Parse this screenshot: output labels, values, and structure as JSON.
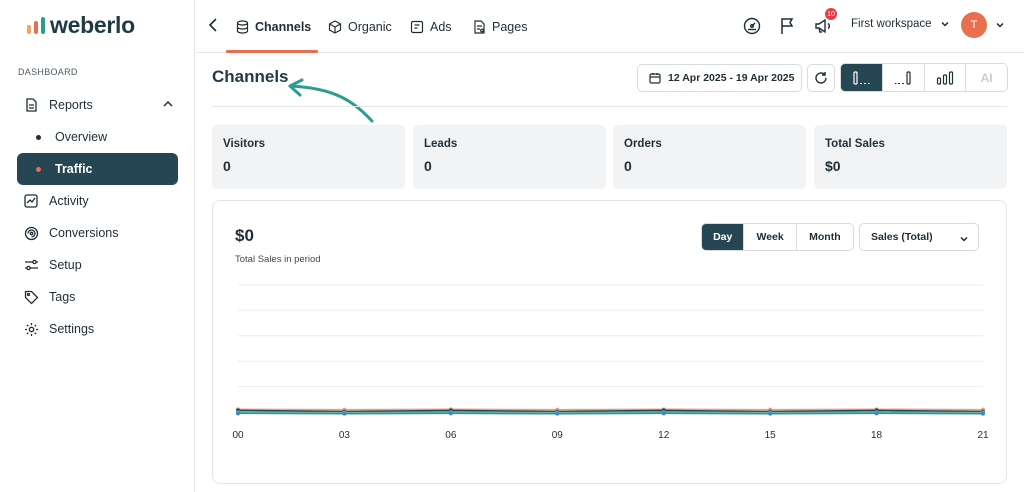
{
  "brand": {
    "name": "weberlo"
  },
  "sidebar": {
    "section_label": "DASHBOARD",
    "reports_label": "Reports",
    "sub_items": [
      {
        "label": "Overview",
        "active": false
      },
      {
        "label": "Traffic",
        "active": true
      }
    ],
    "items": [
      {
        "label": "Activity",
        "icon": "activity-chart-icon"
      },
      {
        "label": "Conversions",
        "icon": "conversions-swirl-icon"
      },
      {
        "label": "Setup",
        "icon": "setup-sliders-icon"
      },
      {
        "label": "Tags",
        "icon": "tag-icon"
      },
      {
        "label": "Settings",
        "icon": "gear-icon"
      }
    ]
  },
  "topnav": {
    "tabs": [
      {
        "label": "Channels",
        "icon": "database-icon",
        "active": true
      },
      {
        "label": "Organic",
        "icon": "cube-icon",
        "active": false
      },
      {
        "label": "Ads",
        "icon": "ad-tag-icon",
        "active": false
      },
      {
        "label": "Pages",
        "icon": "page-icon",
        "active": false
      }
    ],
    "notification_count": "10",
    "workspace": "First workspace",
    "avatar_initial": "T"
  },
  "page": {
    "title": "Channels",
    "date_range": "12 Apr 2025 - 19 Apr 2025",
    "view_ai_label": "AI"
  },
  "stats": [
    {
      "label": "Visitors",
      "value": "0"
    },
    {
      "label": "Leads",
      "value": "0"
    },
    {
      "label": "Orders",
      "value": "0"
    },
    {
      "label": "Total Sales",
      "value": "$0"
    }
  ],
  "chart_panel": {
    "total": "$0",
    "subtitle": "Total Sales in period",
    "periods": [
      {
        "label": "Day",
        "active": true
      },
      {
        "label": "Week",
        "active": false
      },
      {
        "label": "Month",
        "active": false
      }
    ],
    "metric": "Sales (Total)"
  },
  "colors": {
    "primary": "#264653",
    "accent": "#e76f51",
    "series": [
      "#e9a07f",
      "#264653",
      "#6bbf8a",
      "#3a86c8"
    ]
  },
  "chart_data": {
    "type": "line",
    "x": [
      "00",
      "03",
      "06",
      "09",
      "12",
      "15",
      "18",
      "21"
    ],
    "series": [
      {
        "values": [
          0,
          0,
          0,
          0,
          0,
          0,
          0,
          0
        ]
      },
      {
        "values": [
          0,
          0,
          0,
          0,
          0,
          0,
          0,
          0
        ]
      },
      {
        "values": [
          0,
          0,
          0,
          0,
          0,
          0,
          0,
          0
        ]
      },
      {
        "values": [
          0,
          0,
          0,
          0,
          0,
          0,
          0,
          0
        ]
      }
    ],
    "grid": true,
    "xlabel": "",
    "ylabel": ""
  }
}
